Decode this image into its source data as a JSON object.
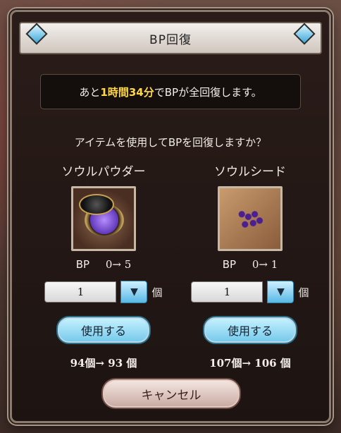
{
  "dialog": {
    "title": "BP回復",
    "notice": {
      "prefix": "あと",
      "time": "1時間34分",
      "suffix": "でBPが全回復します。"
    },
    "question": "アイテムを使用してBPを回復しますか？",
    "items": [
      {
        "name": "ソウルパウダー",
        "bp_label": "BP",
        "bp_change": "0→ 5",
        "quantity": "1",
        "unit": "個",
        "use_label": "使用する",
        "count_change": "94個→ 93 個"
      },
      {
        "name": "ソウルシード",
        "bp_label": "BP",
        "bp_change": "0→ 1",
        "quantity": "1",
        "unit": "個",
        "use_label": "使用する",
        "count_change": "107個→ 106 個"
      }
    ],
    "cancel_label": "キャンセル"
  },
  "colors": {
    "highlight": "#ffd84a",
    "button_blue": "#72c7ea",
    "cancel_pink": "#c7a9a1"
  }
}
